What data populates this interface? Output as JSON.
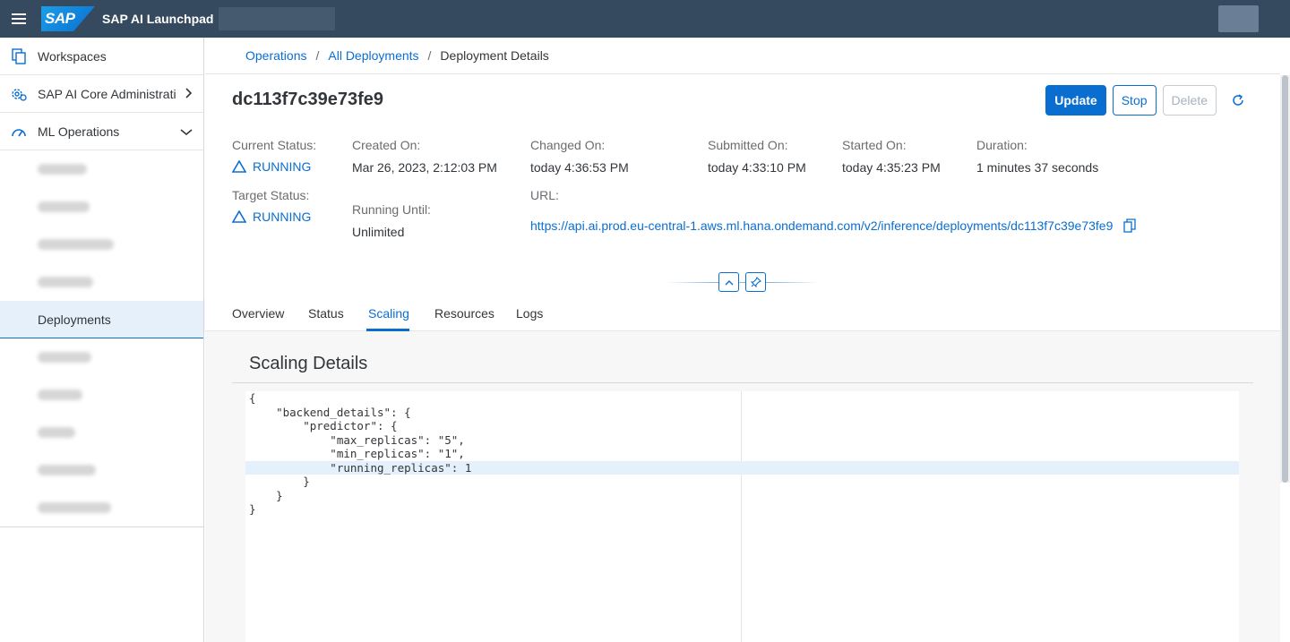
{
  "shell": {
    "logo": "SAP",
    "title": "SAP AI Launchpad"
  },
  "sidebar": {
    "items": [
      {
        "label": "Workspaces"
      },
      {
        "label": "SAP AI Core Administration"
      },
      {
        "label": "ML Operations"
      }
    ],
    "active_sub": "Deployments"
  },
  "breadcrumb": {
    "items": [
      "Operations",
      "All Deployments"
    ],
    "current": "Deployment Details"
  },
  "header": {
    "title": "dc113f7c39e73fe9",
    "update_label": "Update",
    "stop_label": "Stop",
    "delete_label": "Delete"
  },
  "attributes": {
    "current_status_label": "Current Status:",
    "current_status": "RUNNING",
    "target_status_label": "Target Status:",
    "target_status": "RUNNING",
    "created_label": "Created On:",
    "created_value": "Mar 26, 2023, 2:12:03 PM",
    "running_until_label": "Running Until:",
    "running_until_value": "Unlimited",
    "changed_label": "Changed On:",
    "changed_value": "today 4:36:53 PM",
    "url_label": "URL:",
    "url_value": "https://api.ai.prod.eu-central-1.aws.ml.hana.ondemand.com/v2/inference/deployments/dc113f7c39e73fe9",
    "submitted_label": "Submitted On:",
    "submitted_value": "today 4:33:10 PM",
    "started_label": "Started On:",
    "started_value": "today 4:35:23 PM",
    "duration_label": "Duration:",
    "duration_value": "1 minutes 37 seconds"
  },
  "tabs": [
    "Overview",
    "Status",
    "Scaling",
    "Resources",
    "Logs"
  ],
  "active_tab": "Scaling",
  "scaling": {
    "section_title": "Scaling Details",
    "code_lines": [
      "{",
      "    \"backend_details\": {",
      "        \"predictor\": {",
      "            \"max_replicas\": \"5\",",
      "            \"min_replicas\": \"1\",",
      "            \"running_replicas\": 1",
      "        }",
      "    }",
      "}"
    ]
  },
  "colors": {
    "accent": "#0a6ed1",
    "shell": "#354a5f"
  }
}
